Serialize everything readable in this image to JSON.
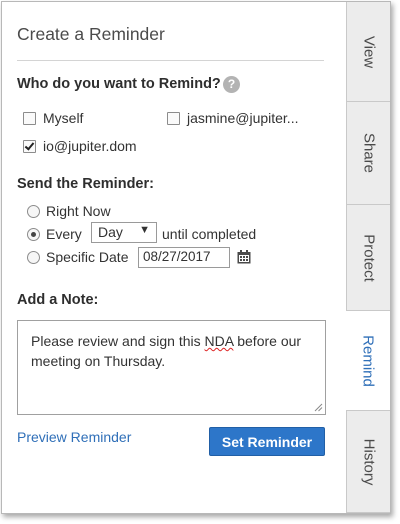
{
  "panel": {
    "title": "Create a Reminder"
  },
  "recipients": {
    "heading": "Who do you want to Remind?",
    "help_icon": "?",
    "options": [
      {
        "label": "Myself",
        "checked": false
      },
      {
        "label": "jasmine@jupiter...",
        "checked": false
      },
      {
        "label": "io@jupiter.dom",
        "checked": true
      }
    ]
  },
  "send": {
    "heading": "Send the Reminder:",
    "right_now_label": "Right Now",
    "every_label": "Every",
    "every_value": "Day",
    "until_label": "until completed",
    "specific_label": "Specific Date",
    "date_value": "08/27/2017",
    "selected": "every"
  },
  "note": {
    "heading": "Add a Note:",
    "text_before": "Please review and sign this ",
    "text_flagged": "NDA",
    "text_after": " before our meeting on Thursday."
  },
  "actions": {
    "preview_label": "Preview Reminder",
    "submit_label": "Set Reminder"
  },
  "tabs": [
    {
      "label": "View",
      "active": false
    },
    {
      "label": "Share",
      "active": false
    },
    {
      "label": "Protect",
      "active": false
    },
    {
      "label": "Remind",
      "active": true
    },
    {
      "label": "History",
      "active": false
    }
  ],
  "colors": {
    "accent": "#2d76c9",
    "link": "#2f6fb8",
    "tab_bg": "#ececec"
  }
}
